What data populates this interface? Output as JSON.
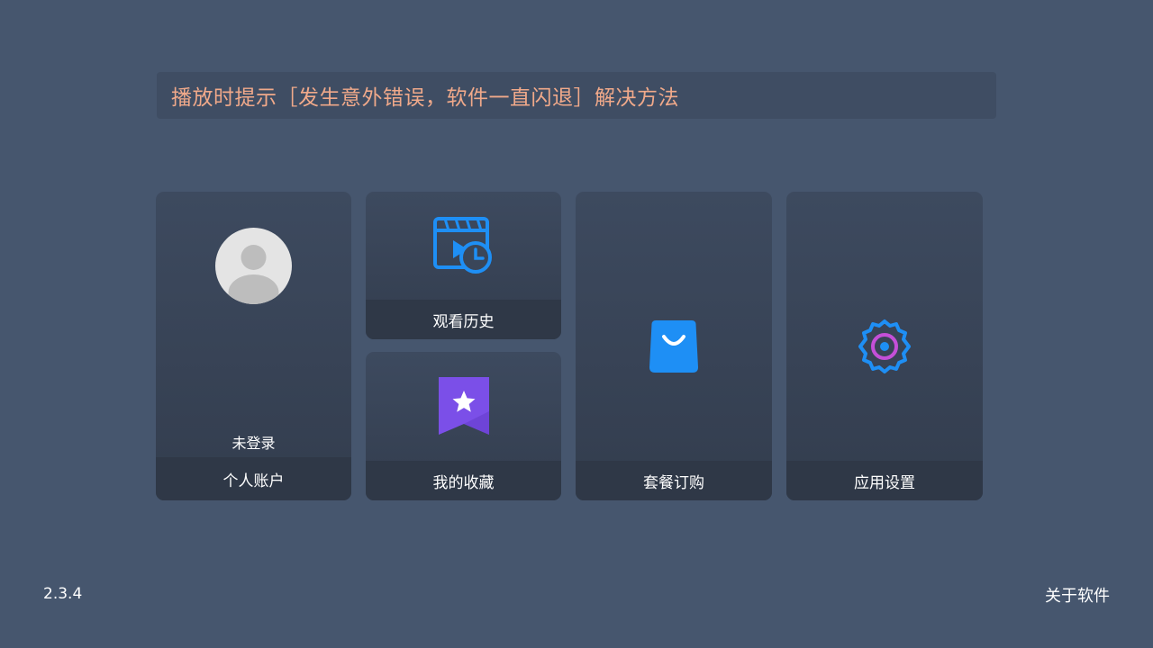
{
  "notice": {
    "text": "播放时提示［发生意外错误，软件一直闪退］解决方法"
  },
  "cards": {
    "account": {
      "label": "个人账户",
      "status": "未登录",
      "icon": "avatar-placeholder-icon"
    },
    "history": {
      "label": "观看历史",
      "icon": "video-history-icon"
    },
    "favorites": {
      "label": "我的收藏",
      "icon": "bookmark-star-icon"
    },
    "subscription": {
      "label": "套餐订购",
      "icon": "shopping-bag-icon"
    },
    "settings": {
      "label": "应用设置",
      "icon": "gear-icon"
    }
  },
  "footer": {
    "version": "2.3.4",
    "about": "关于软件"
  },
  "colors": {
    "background": "#46566e",
    "card": "#3a4659",
    "card_label": "#2f3847",
    "notice_text": "#f0a98a",
    "accent_blue": "#1e90ff",
    "accent_purple": "#7b4fe8"
  }
}
